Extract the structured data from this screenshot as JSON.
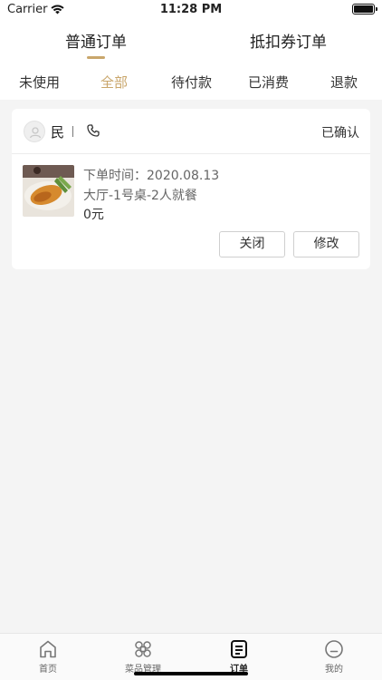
{
  "status_bar": {
    "carrier": "Carrier",
    "time": "11:28 PM"
  },
  "top_tabs": {
    "left": "普通订单",
    "right": "抵扣券订单",
    "active": "left"
  },
  "sub_tabs": {
    "items": [
      {
        "label": "未使用"
      },
      {
        "label": "全部"
      },
      {
        "label": "待付款"
      },
      {
        "label": "已消费"
      },
      {
        "label": "退款"
      }
    ],
    "active_index": 1
  },
  "order": {
    "customer_name": "民",
    "status": "已确认",
    "order_time": "下单时间：2020.08.13",
    "table": "大厅-1号桌-2人就餐",
    "amount": "0元",
    "buttons": {
      "close": "关闭",
      "edit": "修改"
    }
  },
  "bottom_nav": {
    "items": [
      {
        "label": "首页",
        "icon": "home-icon"
      },
      {
        "label": "菜品管理",
        "icon": "dishes-icon"
      },
      {
        "label": "订单",
        "icon": "orders-icon"
      },
      {
        "label": "我的",
        "icon": "profile-icon"
      }
    ],
    "active_index": 2
  },
  "colors": {
    "accent": "#c9a66b",
    "background": "#f4f4f4",
    "card": "#ffffff"
  }
}
